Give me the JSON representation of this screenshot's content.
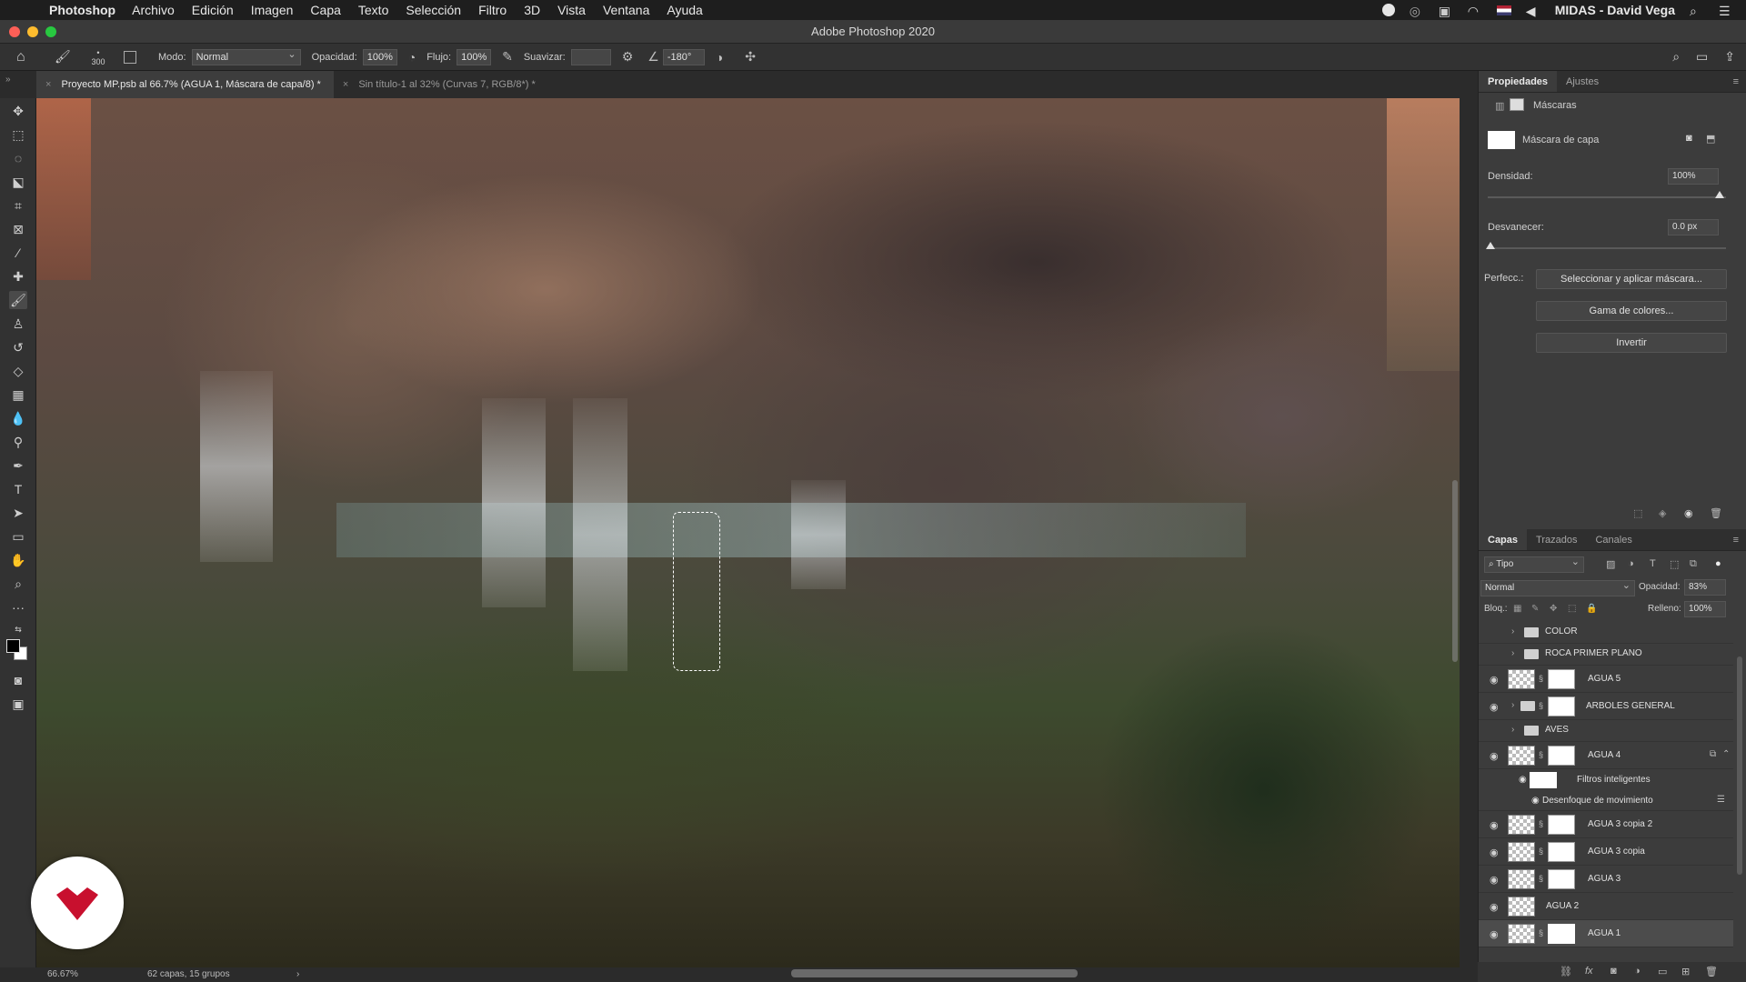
{
  "menubar": {
    "app": "Photoshop",
    "items": [
      "Archivo",
      "Edición",
      "Imagen",
      "Capa",
      "Texto",
      "Selección",
      "Filtro",
      "3D",
      "Vista",
      "Ventana",
      "Ayuda"
    ],
    "user": "MIDAS - David Vega"
  },
  "window": {
    "title": "Adobe Photoshop 2020"
  },
  "options": {
    "brush_size": "300",
    "mode_label": "Modo:",
    "mode_value": "Normal",
    "opacity_label": "Opacidad:",
    "opacity_value": "100%",
    "flow_label": "Flujo:",
    "flow_value": "100%",
    "smooth_label": "Suavizar:",
    "smooth_value": "",
    "angle_value": "-180°"
  },
  "tabs": [
    {
      "label": "Proyecto MP.psb al 66.7% (AGUA 1, Máscara de capa/8) *"
    },
    {
      "label": "Sin título-1 al 32% (Curvas 7, RGB/8*) *"
    }
  ],
  "status": {
    "zoom": "66.67%",
    "info": "62 capas, 15 grupos"
  },
  "properties": {
    "tabs": [
      "Propiedades",
      "Ajustes"
    ],
    "section": "Máscaras",
    "mask_label": "Máscara de capa",
    "density_label": "Densidad:",
    "density_value": "100%",
    "feather_label": "Desvanecer:",
    "feather_value": "0.0 px",
    "refine_label": "Perfecc.:",
    "btn_select": "Seleccionar y aplicar máscara...",
    "btn_color_range": "Gama de colores...",
    "btn_invert": "Invertir"
  },
  "layers_panel": {
    "tabs": [
      "Capas",
      "Trazados",
      "Canales"
    ],
    "filter": "Tipo",
    "blend": "Normal",
    "opacity_label": "Opacidad:",
    "opacity_value": "83%",
    "lock_label": "Bloq.:",
    "fill_label": "Relleno:",
    "fill_value": "100%",
    "layers": [
      {
        "name": "COLOR",
        "kind": "group",
        "visible": false
      },
      {
        "name": "ROCA PRIMER PLANO",
        "kind": "group",
        "visible": false
      },
      {
        "name": "AGUA 5",
        "kind": "layer-mask",
        "visible": true
      },
      {
        "name": "ARBOLES GENERAL",
        "kind": "group-mask",
        "visible": true
      },
      {
        "name": "AVES",
        "kind": "group",
        "visible": false
      },
      {
        "name": "AGUA 4",
        "kind": "layer-mask",
        "visible": true
      },
      {
        "name": "Filtros inteligentes",
        "kind": "smart",
        "visible": true
      },
      {
        "name": "Desenfoque de movimiento",
        "kind": "filter",
        "visible": true
      },
      {
        "name": "AGUA 3 copia 2",
        "kind": "layer-mask",
        "visible": true
      },
      {
        "name": "AGUA 3 copia",
        "kind": "layer-mask",
        "visible": true
      },
      {
        "name": "AGUA 3",
        "kind": "layer-mask",
        "visible": true
      },
      {
        "name": "AGUA 2",
        "kind": "layer",
        "visible": true
      },
      {
        "name": "AGUA 1",
        "kind": "layer-mask",
        "visible": true,
        "selected": true
      }
    ]
  }
}
